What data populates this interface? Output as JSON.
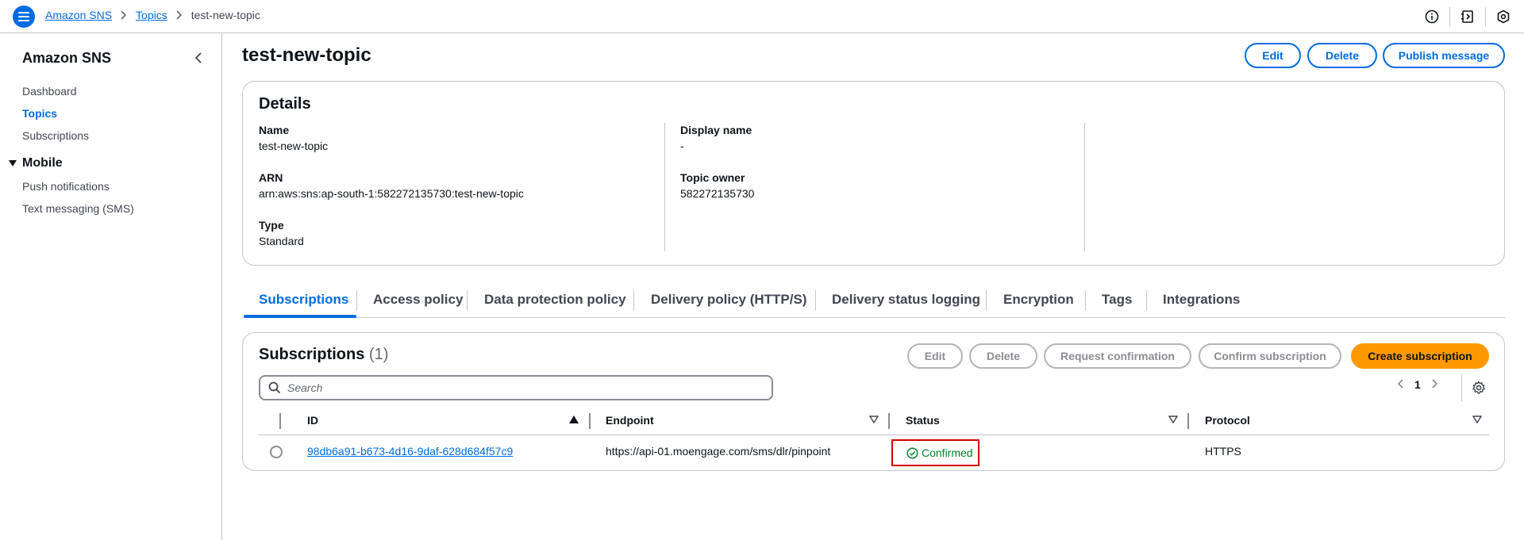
{
  "topbar": {
    "breadcrumbs": [
      "Amazon SNS",
      "Topics",
      "test-new-topic"
    ]
  },
  "sidebar": {
    "title": "Amazon SNS",
    "items": [
      "Dashboard",
      "Topics",
      "Subscriptions"
    ],
    "section": "Mobile",
    "section_items": [
      "Push notifications",
      "Text messaging (SMS)"
    ]
  },
  "page": {
    "title": "test-new-topic",
    "actions": {
      "edit": "Edit",
      "delete": "Delete",
      "publish": "Publish message"
    }
  },
  "details": {
    "title": "Details",
    "name_label": "Name",
    "name_value": "test-new-topic",
    "arn_label": "ARN",
    "arn_value": "arn:aws:sns:ap-south-1:582272135730:test-new-topic",
    "type_label": "Type",
    "type_value": "Standard",
    "display_name_label": "Display name",
    "display_name_value": "-",
    "topic_owner_label": "Topic owner",
    "topic_owner_value": "582272135730"
  },
  "tabs": [
    "Subscriptions",
    "Access policy",
    "Data protection policy",
    "Delivery policy (HTTP/S)",
    "Delivery status logging",
    "Encryption",
    "Tags",
    "Integrations"
  ],
  "subscriptions": {
    "title": "Subscriptions",
    "count": "(1)",
    "buttons": {
      "edit": "Edit",
      "delete": "Delete",
      "request_confirmation": "Request confirmation",
      "confirm_subscription": "Confirm subscription",
      "create_subscription": "Create subscription"
    },
    "search_placeholder": "Search",
    "page": "1",
    "columns": [
      "ID",
      "Endpoint",
      "Status",
      "Protocol"
    ],
    "rows": [
      {
        "id": "98db6a91-b673-4d16-9daf-628d684f57c9",
        "endpoint": "https://api-01.moengage.com/sms/dlr/pinpoint",
        "status": "Confirmed",
        "protocol": "HTTPS"
      }
    ]
  },
  "colors": {
    "accent": "#006ce0",
    "primary_button": "#ff9900",
    "success": "#00802f",
    "highlight": "#d10000"
  }
}
